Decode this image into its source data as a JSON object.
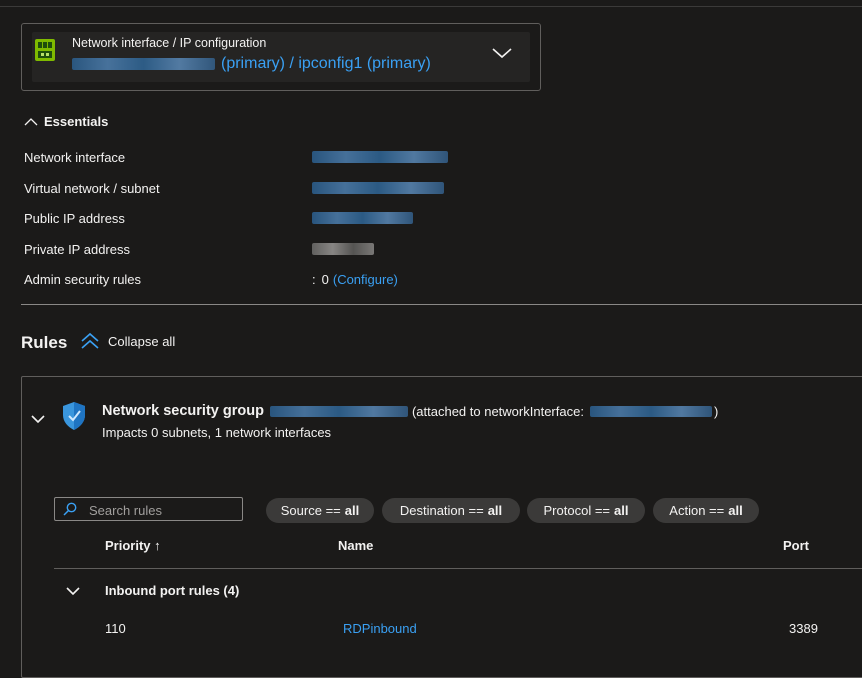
{
  "nic_selector": {
    "label": "Network interface / IP configuration",
    "value_suffix": "(primary) / ipconfig1 (primary)"
  },
  "essentials": {
    "heading": "Essentials",
    "rows": [
      {
        "label": "Network interface",
        "value": ""
      },
      {
        "label": "Virtual network / subnet",
        "value": ""
      },
      {
        "label": "Public IP address",
        "value": ""
      },
      {
        "label": "Private IP address",
        "value": ""
      },
      {
        "label": "Admin security rules",
        "value": "0",
        "link": "(Configure)"
      }
    ],
    "colon": ":"
  },
  "rules": {
    "title": "Rules",
    "collapse_all": "Collapse all"
  },
  "nsg": {
    "title_prefix": "Network security group",
    "attached_prefix": "(attached to networkInterface:",
    "attached_suffix": ")",
    "impacts": "Impacts 0 subnets, 1 network interfaces"
  },
  "filters": {
    "search_placeholder": "Search rules",
    "pills": [
      {
        "label": "Source ==",
        "value": "all"
      },
      {
        "label": "Destination ==",
        "value": "all"
      },
      {
        "label": "Protocol ==",
        "value": "all"
      },
      {
        "label": "Action ==",
        "value": "all"
      }
    ]
  },
  "table": {
    "columns": {
      "priority": "Priority ↑",
      "name": "Name",
      "port": "Port"
    },
    "group": "Inbound port rules (4)",
    "rows": [
      {
        "priority": "110",
        "name": "RDPinbound",
        "port": "3389"
      }
    ]
  },
  "colors": {
    "accent": "#3aa0f3",
    "background": "#1b1a19"
  }
}
